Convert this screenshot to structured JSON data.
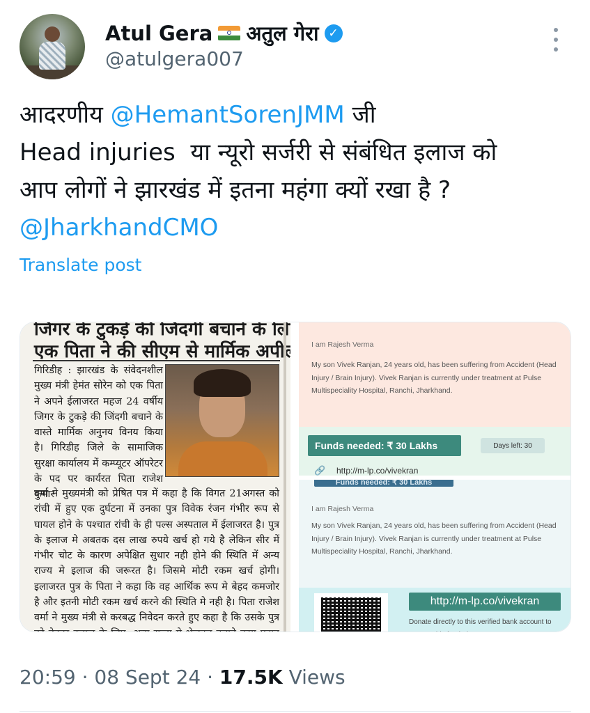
{
  "author": {
    "display_name": "Atul Gera",
    "name_hindi": "अतुल गेरा",
    "handle": "@atulgera007",
    "verified": true,
    "flag_icon": "india-flag-icon"
  },
  "tweet": {
    "line1_prefix": "आदरणीय ",
    "mention1": "@HemantSorenJMM",
    "line1_suffix": " जी",
    "line2": "Head injuries  या न्यूरो सर्जरी से संबंधित इलाज को",
    "line3": "आप लोगों ने झारखंड में इतना महंगा क्यों रखा है ?",
    "mention2": "@JharkhandCMO",
    "translate_label": "Translate post"
  },
  "news_clip": {
    "headline_1": "जिगर के टुकड़े की जिंदगी बचाने के लिए",
    "headline_2": "एक पिता ने की सीएम से मार्मिक अपील",
    "column_text": "गिरिडीह : झारखंड के संवेदनशील मुख्य मंत्री हेमंत सोरेन को एक पिता ने अपने ईलाजरत महज 24 वर्षीय जिगर के टुकड़े की जिंदगी बचाने के वास्ते मार्मिक अनुनय विनय किया है। गिरिडीह जिले के सामाजिक सुरक्षा कार्यालय में कम्प्यूटर ऑपरेटर के पद पर कार्यरत पिता राजेश कुमार",
    "body_text": "वर्मा ने मुख्यमंत्री को प्रेषित पत्र में कहा है कि विगत 21अगस्त को रांची में हुए एक दुर्घटना में उनका पुत्र विवेक रंजन गंभीर रूप से घायल होने के पश्चात रांची के ही पल्स अस्पताल में ईलाजरत है। पुत्र के इलाज मे अबतक दस लाख रुपये खर्च हो गये है लेकिन सीर में गंभीर चोट के कारण अपेक्षित सुधार नही होने की स्थिति में अन्य राज्य मे इलाज की जरूरत है। जिसमे मोटी रकम खर्च होगी। इलाजरत पुत्र के पिता ने कहा कि वह आर्थिक रूप मे बेहद कमजोर है और इतनी मोटी रकम खर्च करने की स्थिति मे नही है। पिता राजेश वर्मा ने मुख्य मंत्री से करबद्ध निवेदन करते हुए कहा है कि उसके पुत्र को बेहतर इलाज के लिए, अन्य राज्य मे भेजकर कराने कृपा प्रदान की जाय। इसके के लिए उनका परिवार सीएम सोरेन का"
  },
  "fundraiser_top": {
    "who": "I am Rajesh Verma",
    "description": "My son Vivek Ranjan, 24 years old, has been suffering from Accident (Head Injury / Brain Injury). Vivek Ranjan is currently under treatment at Pulse Multispeciality Hospital, Ranchi, Jharkhand.",
    "funds_label": "Funds needed: ₹ 30 Lakhs",
    "days_left": "Days left: 30",
    "url": "http://m-lp.co/vivekran"
  },
  "fundraiser_bottom": {
    "strip_label": "Funds needed: ₹ 30 Lakhs",
    "who": "I am Rajesh Verma",
    "description": "My son Vivek Ranjan, 24 years old, has been suffering from Accident (Head Injury / Brain Injury). Vivek Ranjan is currently under treatment at Pulse Multispeciality Hospital, Ranchi, Jharkhand.",
    "qr_url": "http://m-lp.co/vivekran",
    "donate_text": "Donate directly to this verified bank account to support this fundraiser"
  },
  "meta": {
    "time": "20:59",
    "separator": " · ",
    "date": "08 Sept 24",
    "views_count": "17.5K",
    "views_label": " Views"
  },
  "colors": {
    "accent": "#1d9bf0",
    "muted": "#536471",
    "text": "#0f1419"
  }
}
